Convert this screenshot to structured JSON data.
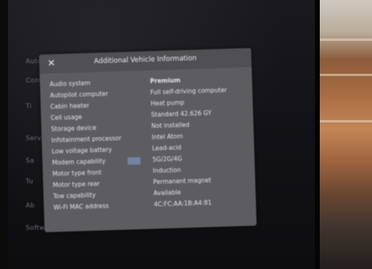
{
  "dialog": {
    "title": "Additional Vehicle Information",
    "close_icon": "close-icon",
    "rows": [
      {
        "label": "Audio system",
        "value": "Premium"
      },
      {
        "label": "Autopilot computer",
        "value": "Full self-driving computer"
      },
      {
        "label": "Cabin heater",
        "value": "Heat pump"
      },
      {
        "label": "Cell usage",
        "value": "Standard 42.626 GY"
      },
      {
        "label": "Storage device",
        "value": "Not installed"
      },
      {
        "label": "Infotainment processor",
        "value": "Intel Atom"
      },
      {
        "label": "Low voltage battery",
        "value": "Lead-acid"
      },
      {
        "label": "Modem capability",
        "value": "5G/2G/4G"
      },
      {
        "label": "Motor type front",
        "value": "Induction"
      },
      {
        "label": "Motor type rear",
        "value": "Permanent magnet"
      },
      {
        "label": "Tow capability",
        "value": "Available"
      },
      {
        "label": "Wi-Fi MAC address",
        "value": "4C:FC:AA:1B:A4:81"
      }
    ]
  },
  "background_text": [
    "Auto",
    "Controls",
    "Ti",
    "Service",
    "Sa",
    "Tu",
    "Ab",
    "Software"
  ],
  "colors": {
    "panel": "#5d5d61",
    "header": "#505054",
    "text": "#e3e3e8",
    "screen": "#131317"
  }
}
